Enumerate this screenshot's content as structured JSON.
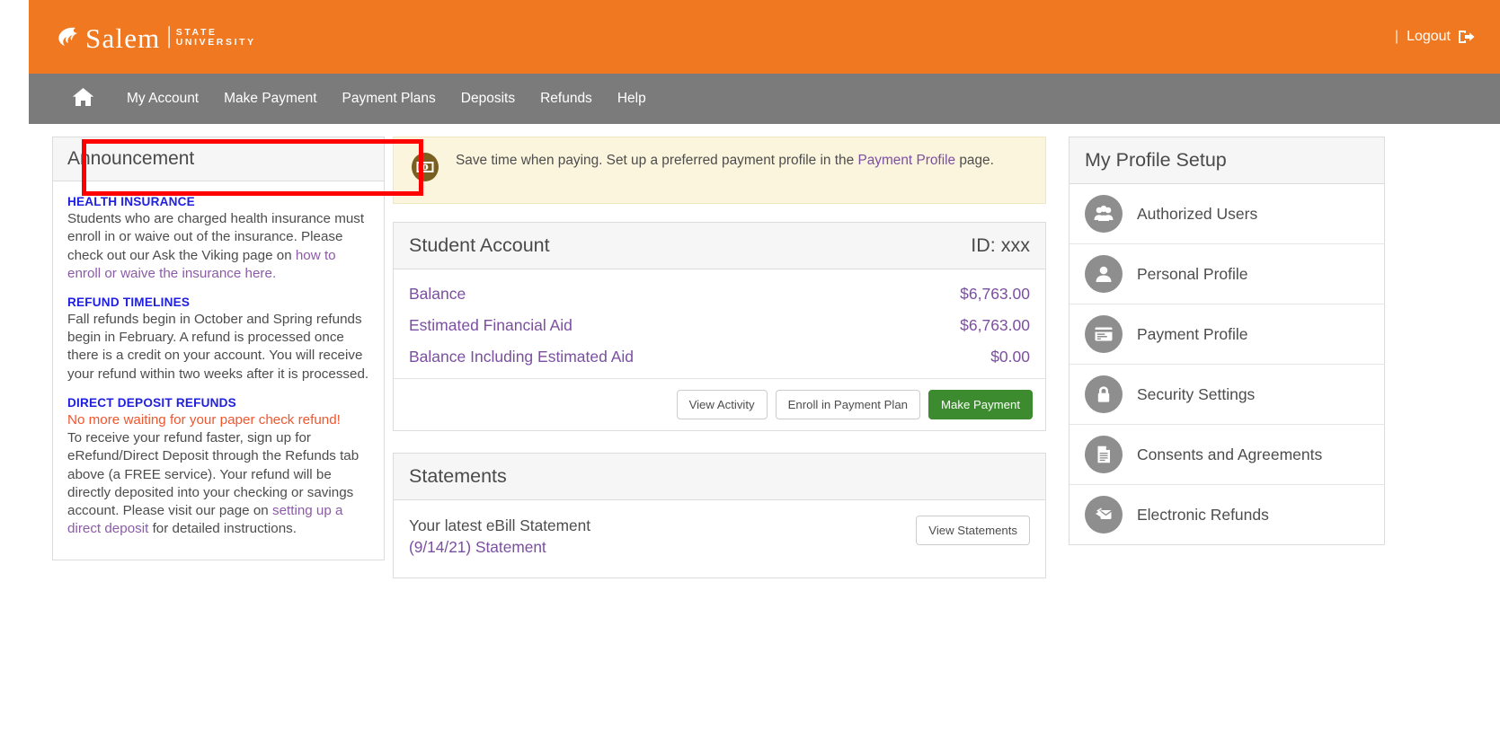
{
  "header": {
    "logo_name": "Salem",
    "logo_sub_line1": "STATE",
    "logo_sub_line2": "UNIVERSITY",
    "separator": "|",
    "logout_label": "Logout",
    "logout_sep": "|",
    "brand_color": "#f07820"
  },
  "nav": {
    "home_icon": "home-icon",
    "items": [
      {
        "label": "My Account"
      },
      {
        "label": "Make Payment"
      },
      {
        "label": "Payment Plans"
      },
      {
        "label": "Deposits"
      },
      {
        "label": "Refunds"
      },
      {
        "label": "Help"
      }
    ],
    "bar_color": "#7b7b7b"
  },
  "announcement": {
    "title": "Announcement",
    "highlight_color": "#ff0000",
    "blocks": [
      {
        "heading": "HEALTH INSURANCE",
        "text_1": "Students who are charged health insurance must enroll in or waive out of the insurance.  Please check out our Ask the Viking page on ",
        "link": "how to enroll or waive the insurance here.",
        "text_2": ""
      },
      {
        "heading": "REFUND TIMELINES",
        "text_1": "Fall refunds begin in October and Spring refunds begin in February.  A refund is processed once there is a credit on your account.  You will receive your refund within two weeks after it is processed.",
        "link": "",
        "text_2": ""
      },
      {
        "heading": "DIRECT DEPOSIT REFUNDS",
        "emphasis": "No more waiting for your paper check refund!",
        "text_1": "To receive your refund faster, sign up for eRefund/Direct Deposit through the Refunds tab above (a FREE service). Your refund will be directly deposited into your checking or savings account. Please visit our page on ",
        "link": "setting up a direct deposit",
        "text_2": " for detailed instructions."
      }
    ]
  },
  "notice": {
    "icon": "info-card-icon",
    "text_before": "Save time when paying. Set up a preferred payment profile in the ",
    "link": "Payment Profile",
    "text_after": " page.",
    "bg_color": "#fcf5dd"
  },
  "student_account": {
    "title": "Student Account",
    "id_label": "ID: xxx",
    "rows": [
      {
        "label": "Balance",
        "value": "$6,763.00"
      },
      {
        "label": "Estimated Financial Aid",
        "value": "$6,763.00"
      },
      {
        "label": "Balance Including Estimated Aid",
        "value": "$0.00"
      }
    ],
    "buttons": {
      "view_activity": "View Activity",
      "enroll_plan": "Enroll in Payment Plan",
      "make_payment": "Make Payment",
      "make_payment_color": "#3c8c2f"
    }
  },
  "statements": {
    "title": "Statements",
    "latest_label": "Your latest eBill Statement",
    "latest_link": "(9/14/21) Statement",
    "view_button": "View Statements"
  },
  "profile_setup": {
    "title": "My Profile Setup",
    "items": [
      {
        "label": "Authorized Users",
        "icon": "users-icon"
      },
      {
        "label": "Personal Profile",
        "icon": "person-icon"
      },
      {
        "label": "Payment Profile",
        "icon": "credit-card-icon"
      },
      {
        "label": "Security Settings",
        "icon": "lock-icon"
      },
      {
        "label": "Consents and Agreements",
        "icon": "document-icon"
      },
      {
        "label": "Electronic Refunds",
        "icon": "refund-envelope-icon"
      }
    ]
  }
}
